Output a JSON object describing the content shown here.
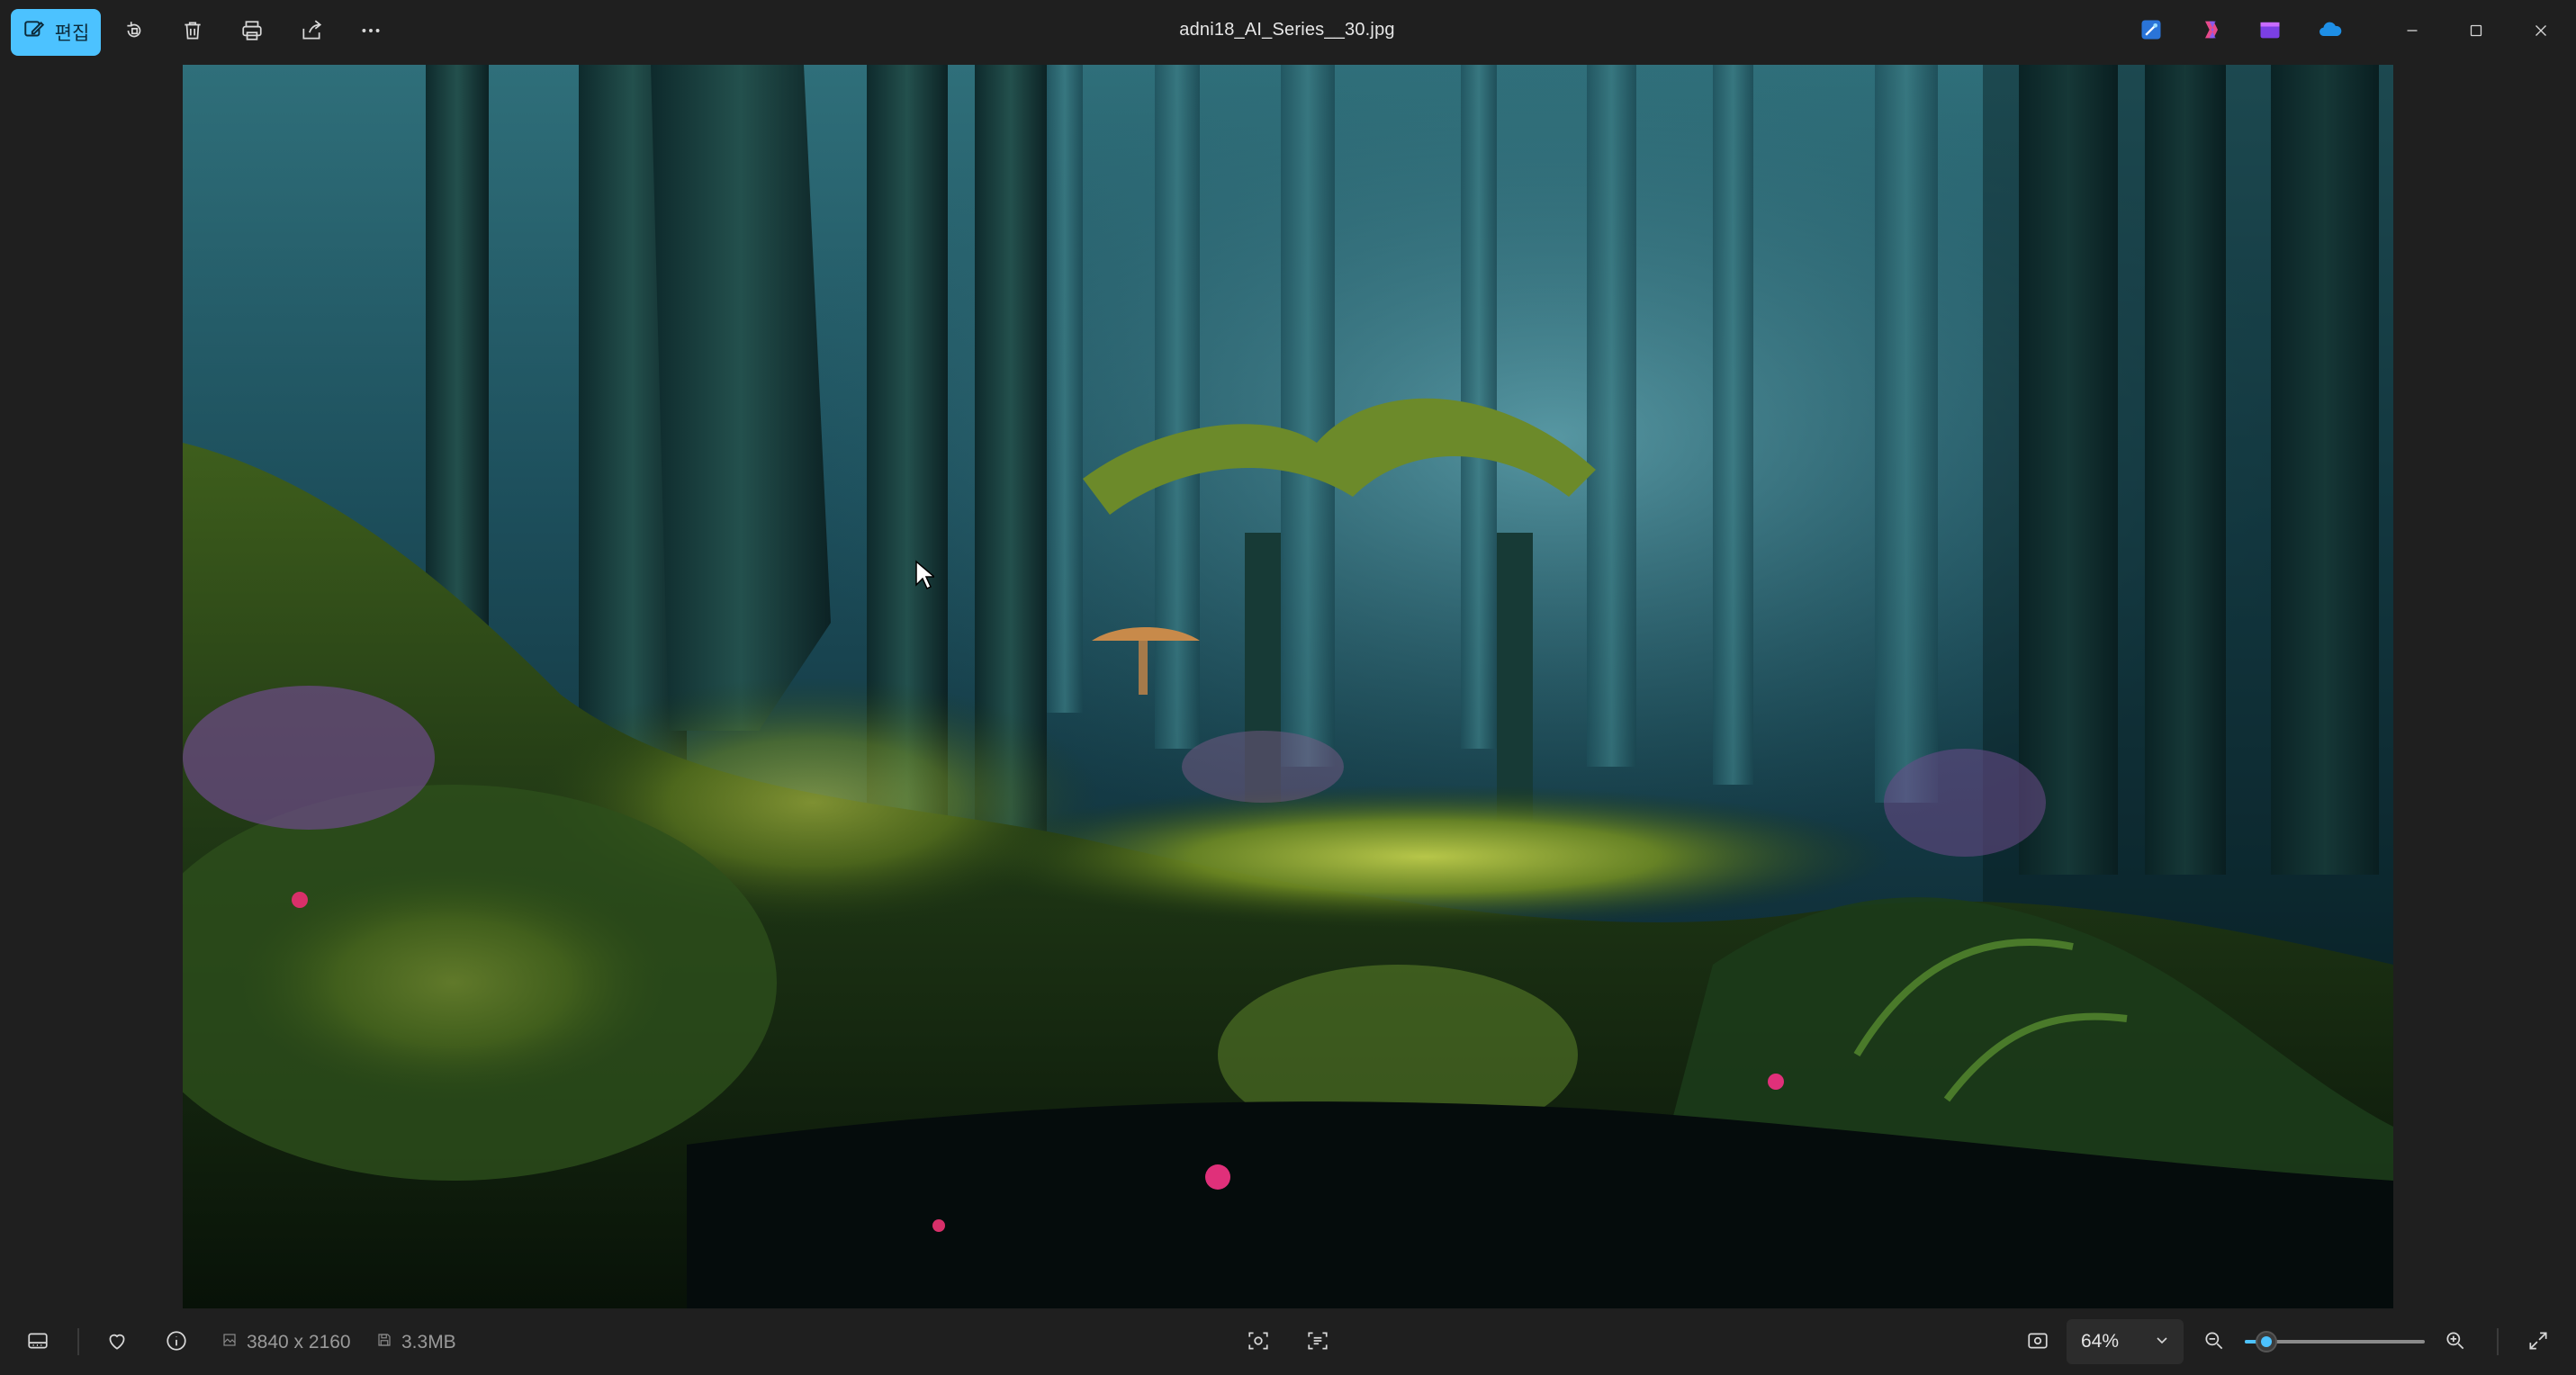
{
  "toolbar": {
    "edit_label": "편집",
    "icons": [
      "edit-icon",
      "rotate-icon",
      "delete-icon",
      "print-icon",
      "share-icon",
      "more-icon"
    ]
  },
  "window": {
    "title": "adni18_AI_Series__30.jpg",
    "apps": [
      "designer-icon",
      "copilot-icon",
      "clipchamp-icon",
      "onedrive-icon"
    ],
    "controls": [
      "minimize-icon",
      "maximize-icon",
      "close-icon"
    ]
  },
  "image": {
    "description_colors": {
      "accent": "#4cc2ff",
      "background": "#1f1f1f"
    }
  },
  "statusbar": {
    "dimensions": "3840 x 2160",
    "file_size": "3.3MB",
    "zoom_value": "64%",
    "zoom_level": 0.12
  }
}
